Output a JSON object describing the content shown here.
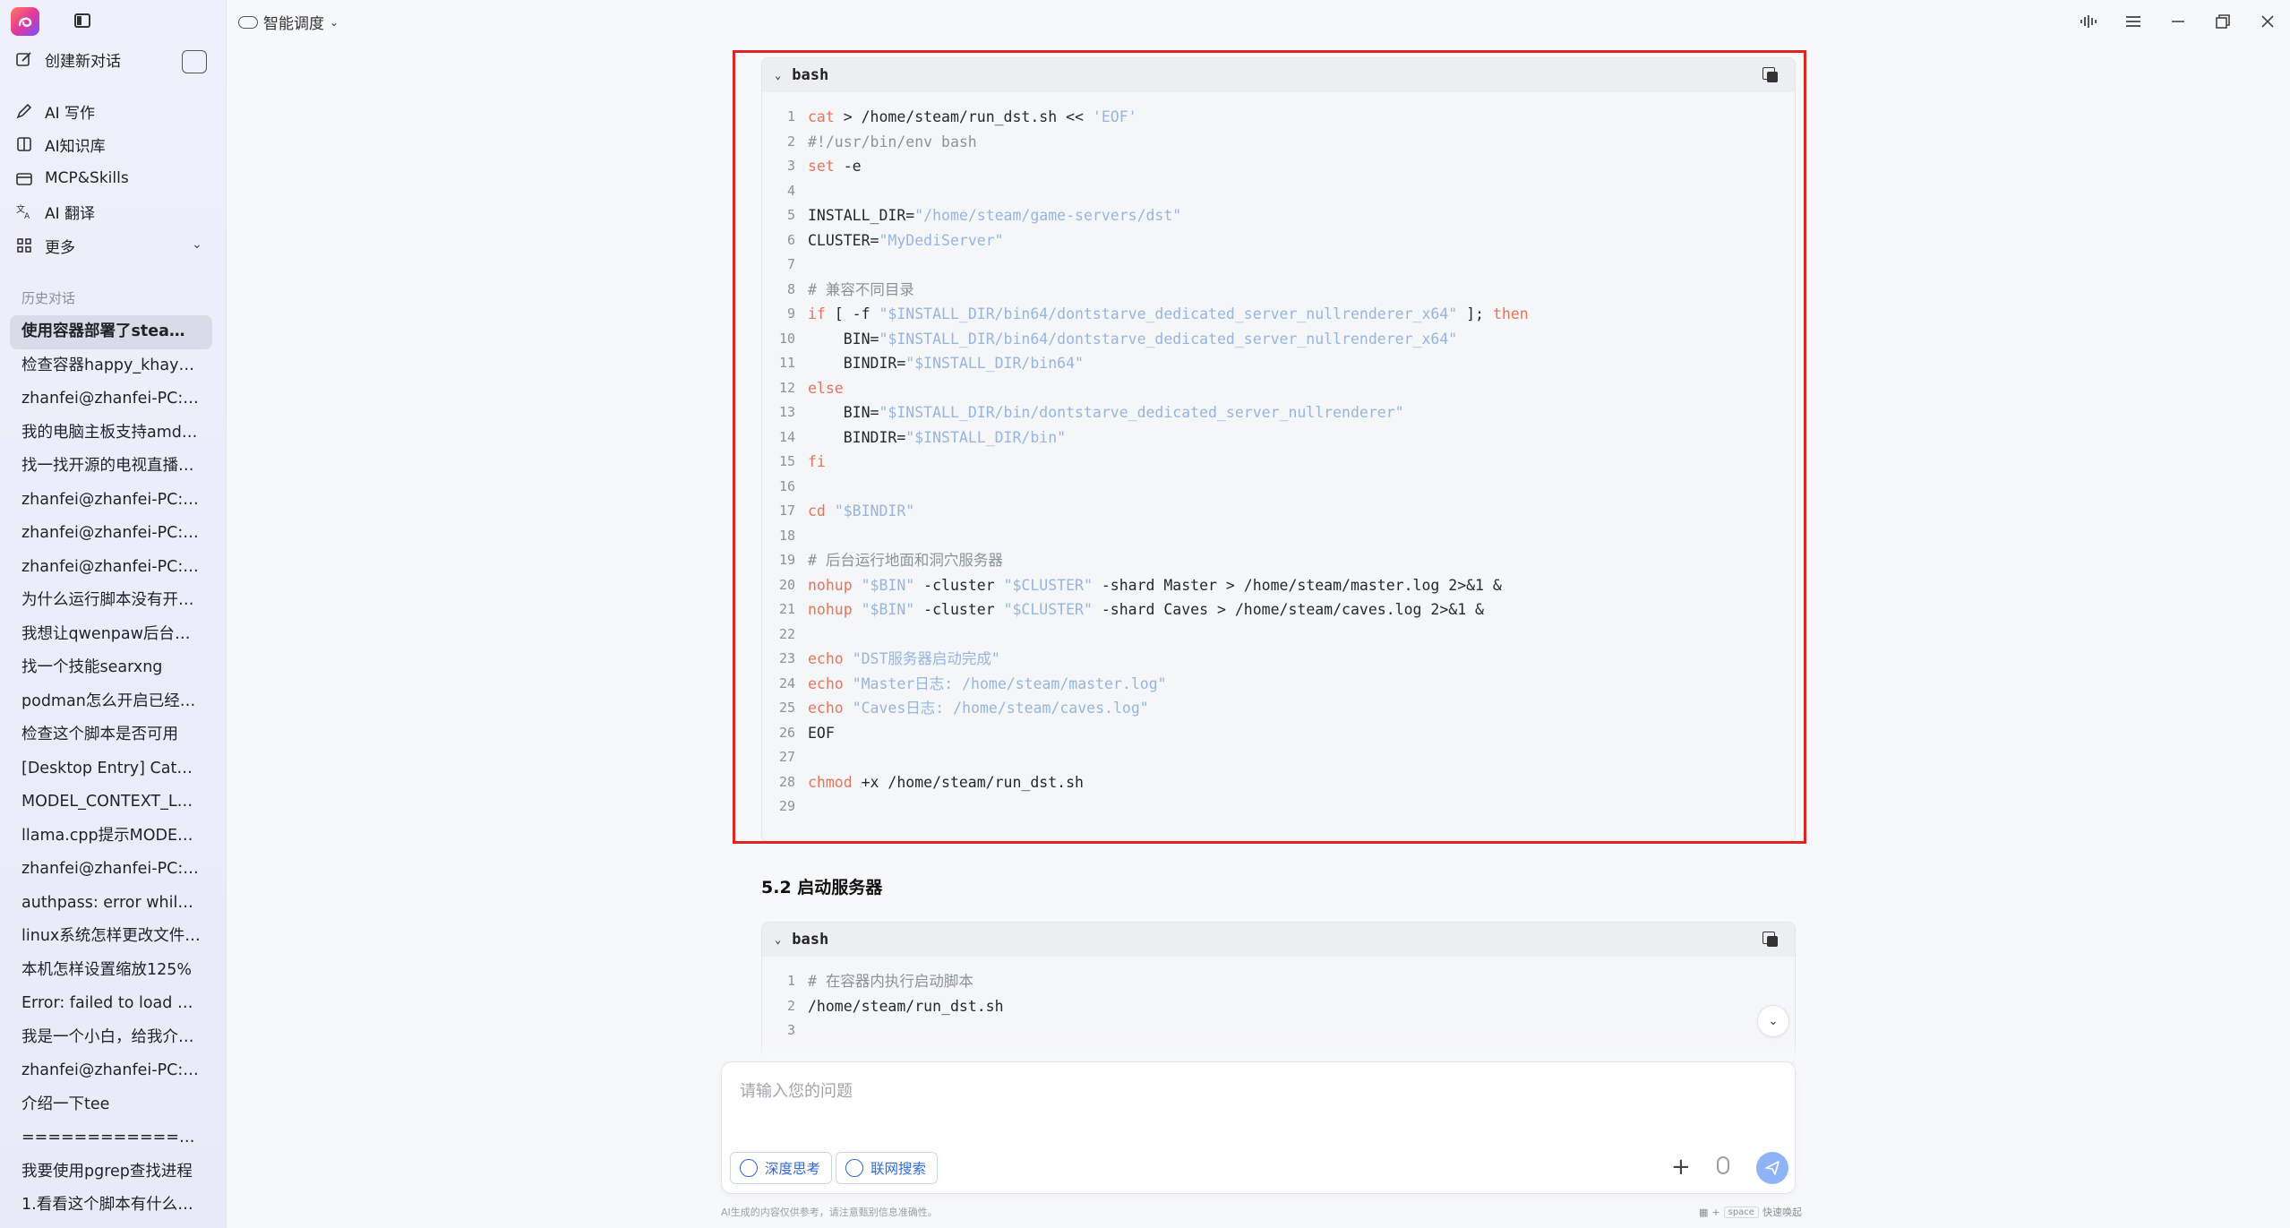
{
  "sidebar": {
    "new_chat": "创建新对话",
    "nav": [
      {
        "label": "AI 写作",
        "icon": "pen-icon"
      },
      {
        "label": "AI知识库",
        "icon": "book-icon"
      },
      {
        "label": "MCP&Skills",
        "icon": "toolbox-icon"
      },
      {
        "label": "AI 翻译",
        "icon": "translate-icon"
      },
      {
        "label": "更多",
        "icon": "grid-icon"
      }
    ],
    "history_title": "历史对话",
    "history": [
      "使用容器部署了steamcmd",
      "检查容器happy_khayyam",
      "zhanfei@zhanfei-PC:~$",
      "我的电脑主板支持amd处理器",
      "找一找开源的电视直播软件",
      "zhanfei@zhanfei-PC:~$",
      "zhanfei@zhanfei-PC:~$",
      "zhanfei@zhanfei-PC:~$",
      "为什么运行脚本没有开机自启",
      "我想让qwenpaw后台运行",
      "找一个技能searxng",
      "podman怎么开启已经停止的容器",
      "检查这个脚本是否可用",
      "[Desktop Entry] Categories",
      "MODEL_CONTEXT_LENGTH",
      "llama.cpp提示MODEL_CONTEXT",
      "zhanfei@zhanfei-PC:~$",
      "authpass: error while loading",
      "linux系统怎样更改文件权限",
      "本机怎样设置缩放125%",
      "Error: failed to load model",
      "我是一个小白，给我介绍一下",
      "zhanfei@zhanfei-PC:~$",
      "介绍一下tee",
      "====================",
      "我要使用pgrep查找进程",
      "1.看看这个脚本有什么问题"
    ]
  },
  "topbar": {
    "mode": "智能调度"
  },
  "code_block_1": {
    "lang": "bash",
    "lines": [
      [
        [
          "kw",
          "cat"
        ],
        [
          "txt",
          " > /home/steam/run_dst.sh << "
        ],
        [
          "str",
          "'EOF'"
        ]
      ],
      [
        [
          "cmt",
          "#!/usr/bin/env bash"
        ]
      ],
      [
        [
          "kw",
          "set"
        ],
        [
          "txt",
          " -e"
        ]
      ],
      [],
      [
        [
          "txt",
          "INSTALL_DIR="
        ],
        [
          "str",
          "\"/home/steam/game-servers/dst\""
        ]
      ],
      [
        [
          "txt",
          "CLUSTER="
        ],
        [
          "str",
          "\"MyDediServer\""
        ]
      ],
      [],
      [
        [
          "cmt",
          "# 兼容不同目录"
        ]
      ],
      [
        [
          "kw",
          "if"
        ],
        [
          "txt",
          " [ -f "
        ],
        [
          "str",
          "\"$INSTALL_DIR/bin64/dontstarve_dedicated_server_nullrenderer_x64\""
        ],
        [
          "txt",
          " ]; "
        ],
        [
          "kw",
          "then"
        ]
      ],
      [
        [
          "txt",
          "    BIN="
        ],
        [
          "str",
          "\"$INSTALL_DIR/bin64/dontstarve_dedicated_server_nullrenderer_x64\""
        ]
      ],
      [
        [
          "txt",
          "    BINDIR="
        ],
        [
          "str",
          "\"$INSTALL_DIR/bin64\""
        ]
      ],
      [
        [
          "kw",
          "else"
        ]
      ],
      [
        [
          "txt",
          "    BIN="
        ],
        [
          "str",
          "\"$INSTALL_DIR/bin/dontstarve_dedicated_server_nullrenderer\""
        ]
      ],
      [
        [
          "txt",
          "    BINDIR="
        ],
        [
          "str",
          "\"$INSTALL_DIR/bin\""
        ]
      ],
      [
        [
          "kw",
          "fi"
        ]
      ],
      [],
      [
        [
          "kw",
          "cd"
        ],
        [
          "txt",
          " "
        ],
        [
          "str",
          "\"$BINDIR\""
        ]
      ],
      [],
      [
        [
          "cmt",
          "# 后台运行地面和洞穴服务器"
        ]
      ],
      [
        [
          "kw",
          "nohup"
        ],
        [
          "txt",
          " "
        ],
        [
          "str",
          "\"$BIN\""
        ],
        [
          "txt",
          " -cluster "
        ],
        [
          "str",
          "\"$CLUSTER\""
        ],
        [
          "txt",
          " -shard Master > /home/steam/master.log 2>&1 &"
        ]
      ],
      [
        [
          "kw",
          "nohup"
        ],
        [
          "txt",
          " "
        ],
        [
          "str",
          "\"$BIN\""
        ],
        [
          "txt",
          " -cluster "
        ],
        [
          "str",
          "\"$CLUSTER\""
        ],
        [
          "txt",
          " -shard Caves > /home/steam/caves.log 2>&1 &"
        ]
      ],
      [],
      [
        [
          "kw",
          "echo"
        ],
        [
          "txt",
          " "
        ],
        [
          "str",
          "\"DST服务器启动完成\""
        ]
      ],
      [
        [
          "kw",
          "echo"
        ],
        [
          "txt",
          " "
        ],
        [
          "str",
          "\"Master日志: /home/steam/master.log\""
        ]
      ],
      [
        [
          "kw",
          "echo"
        ],
        [
          "txt",
          " "
        ],
        [
          "str",
          "\"Caves日志: /home/steam/caves.log\""
        ]
      ],
      [
        [
          "txt",
          "EOF"
        ]
      ],
      [],
      [
        [
          "kw",
          "chmod"
        ],
        [
          "txt",
          " +x /home/steam/run_dst.sh"
        ]
      ],
      []
    ]
  },
  "section_heading": "5.2 启动服务器",
  "code_block_2": {
    "lang": "bash",
    "lines": [
      [
        [
          "cmt",
          "# 在容器内执行启动脚本"
        ]
      ],
      [
        [
          "txt",
          "/home/steam/run_dst.sh"
        ]
      ],
      []
    ]
  },
  "input": {
    "placeholder": "请输入您的问题",
    "deep_think": "深度思考",
    "web_search": "联网搜索"
  },
  "footer": {
    "note": "AI生成的内容仅供参考，请注意甄别信息准确性。",
    "key": "space",
    "hint": "快速唤起"
  }
}
